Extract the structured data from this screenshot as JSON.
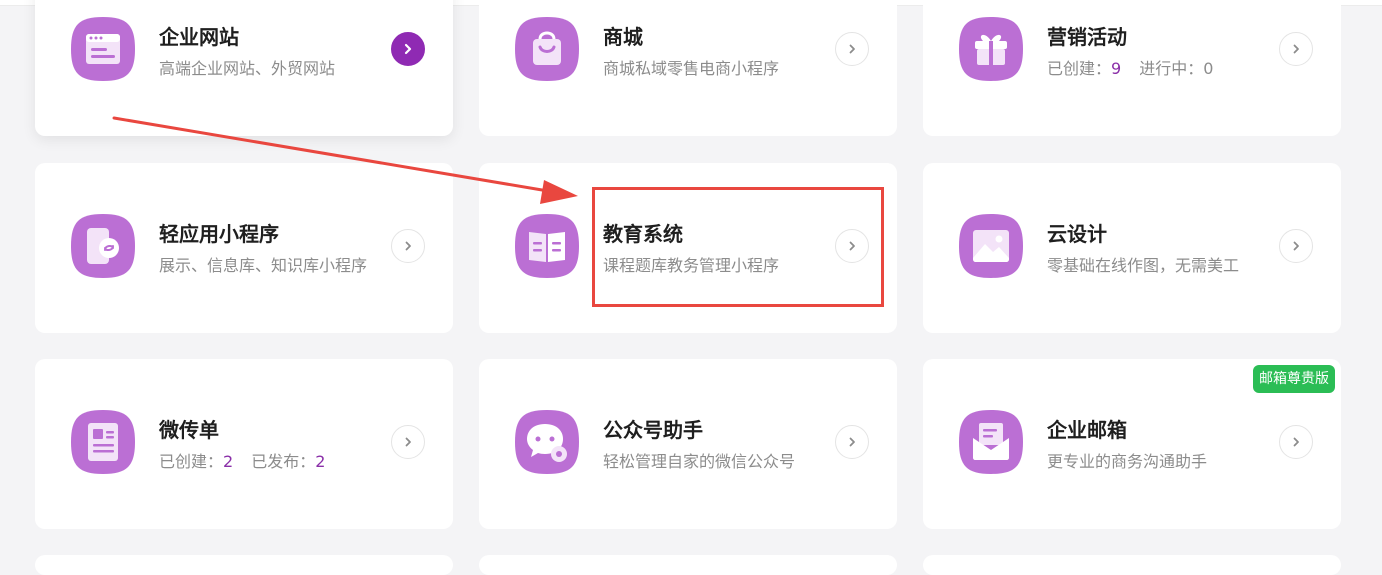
{
  "cards": [
    {
      "title": "企业网站",
      "subtitle": "高端企业网站、外贸网站",
      "icon": "website-browser-icon"
    },
    {
      "title": "商城",
      "subtitle": "商城私域零售电商小程序",
      "icon": "shopping-bag-icon"
    },
    {
      "title": "营销活动",
      "stats": [
        {
          "label": "已创建：",
          "value": "9"
        },
        {
          "label": "进行中：",
          "value": "0"
        }
      ],
      "icon": "gift-icon"
    },
    {
      "title": "轻应用小程序",
      "subtitle": "展示、信息库、知识库小程序",
      "icon": "mini-program-phone-icon"
    },
    {
      "title": "教育系统",
      "subtitle": "课程题库教务管理小程序",
      "icon": "open-book-icon"
    },
    {
      "title": "云设计",
      "subtitle": "零基础在线作图，无需美工",
      "icon": "picture-icon"
    },
    {
      "title": "微传单",
      "stats": [
        {
          "label": "已创建：",
          "value": "2"
        },
        {
          "label": "已发布：",
          "value": "2"
        }
      ],
      "icon": "flyer-icon"
    },
    {
      "title": "公众号助手",
      "subtitle": "轻松管理自家的微信公众号",
      "icon": "wechat-gear-icon"
    },
    {
      "title": "企业邮箱",
      "subtitle": "更专业的商务沟通助手",
      "badge": "邮箱尊贵版",
      "icon": "envelope-icon"
    }
  ],
  "colors": {
    "accent": "#8f2ab3",
    "icon_bg": "#bb6fd4",
    "badge": "#2bbd55",
    "annotation": "#e9473f"
  }
}
